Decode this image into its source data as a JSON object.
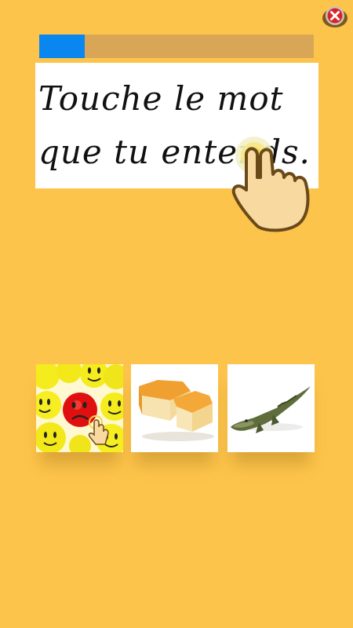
{
  "instruction": {
    "text": "Touche le mot\nque tu entends."
  },
  "progress": {
    "fraction": 0.165,
    "fill_color": "#0a86f0",
    "track_color": "#d9a657"
  },
  "close_button": {
    "icon": "close-icon"
  },
  "hand_hint": {
    "icon": "pointing-hand-icon"
  },
  "choices": [
    {
      "name": "choice-smileys",
      "icon": "smiley-faces-image"
    },
    {
      "name": "choice-cheese",
      "icon": "cheese-image"
    },
    {
      "name": "choice-crocodile",
      "icon": "crocodile-image"
    }
  ],
  "colors": {
    "background": "#fdc44b",
    "accent": "#0a86f0"
  }
}
